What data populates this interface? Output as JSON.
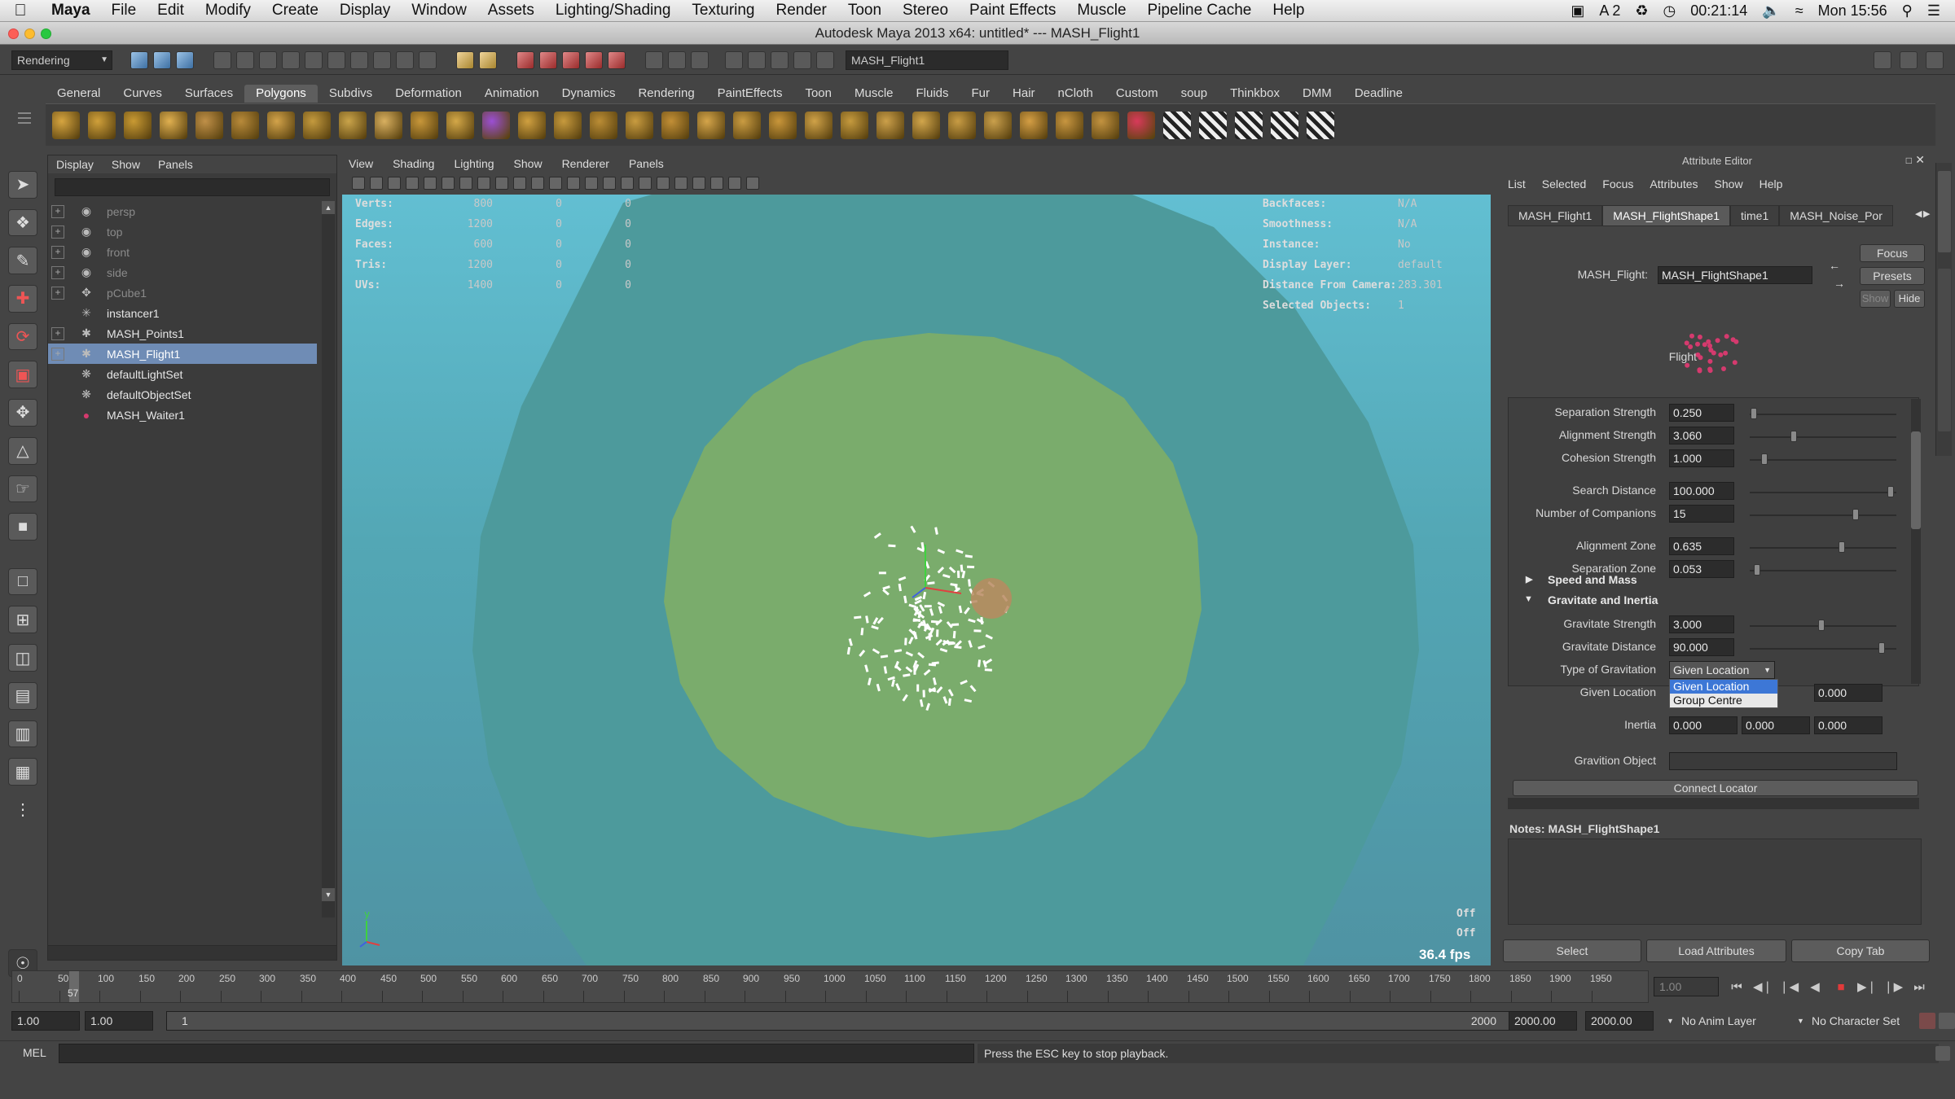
{
  "menubar": {
    "app": "Maya",
    "items": [
      "File",
      "Edit",
      "Modify",
      "Create",
      "Display",
      "Window",
      "Assets",
      "Lighting/Shading",
      "Texturing",
      "Render",
      "Toon",
      "Stereo",
      "Paint Effects",
      "Muscle",
      "Pipeline Cache",
      "Help"
    ],
    "status_a2": "A 2",
    "battery_time": "00:21:14",
    "clock": "Mon 15:56"
  },
  "window": {
    "title": "Autodesk Maya 2013 x64: untitled*   ---   MASH_Flight1"
  },
  "statusline": {
    "menuset": "Rendering",
    "selection_field": "MASH_Flight1"
  },
  "shelf": {
    "tabs": [
      "General",
      "Curves",
      "Surfaces",
      "Polygons",
      "Subdivs",
      "Deformation",
      "Animation",
      "Dynamics",
      "Rendering",
      "PaintEffects",
      "Toon",
      "Muscle",
      "Fluids",
      "Fur",
      "Hair",
      "nCloth",
      "Custom",
      "soup",
      "Thinkbox",
      "DMM",
      "Deadline"
    ],
    "active": "Polygons"
  },
  "outliner": {
    "menu": [
      "Display",
      "Show",
      "Panels"
    ],
    "items": [
      {
        "label": "persp",
        "dim": true,
        "expand": true,
        "icon": "camera-icon"
      },
      {
        "label": "top",
        "dim": true,
        "expand": true,
        "icon": "camera-icon"
      },
      {
        "label": "front",
        "dim": true,
        "expand": true,
        "icon": "camera-icon"
      },
      {
        "label": "side",
        "dim": true,
        "expand": true,
        "icon": "camera-icon"
      },
      {
        "label": "pCube1",
        "dim": true,
        "expand": true,
        "icon": "transform-icon"
      },
      {
        "label": "instancer1",
        "dim": false,
        "expand": false,
        "icon": "instancer-icon"
      },
      {
        "label": "MASH_Points1",
        "dim": false,
        "expand": true,
        "icon": "mash-icon"
      },
      {
        "label": "MASH_Flight1",
        "dim": false,
        "expand": true,
        "icon": "mash-icon",
        "selected": true
      },
      {
        "label": "defaultLightSet",
        "dim": false,
        "expand": false,
        "icon": "set-icon"
      },
      {
        "label": "defaultObjectSet",
        "dim": false,
        "expand": false,
        "icon": "set-icon"
      },
      {
        "label": "MASH_Waiter1",
        "dim": false,
        "expand": false,
        "icon": "mash-waiter-icon"
      }
    ]
  },
  "viewport": {
    "menu": [
      "View",
      "Shading",
      "Lighting",
      "Show",
      "Renderer",
      "Panels"
    ],
    "hud_left": [
      {
        "label": "Verts:",
        "v1": "800",
        "v2": "0",
        "v3": "0"
      },
      {
        "label": "Edges:",
        "v1": "1200",
        "v2": "0",
        "v3": "0"
      },
      {
        "label": "Faces:",
        "v1": "600",
        "v2": "0",
        "v3": "0"
      },
      {
        "label": "Tris:",
        "v1": "1200",
        "v2": "0",
        "v3": "0"
      },
      {
        "label": "UVs:",
        "v1": "1400",
        "v2": "0",
        "v3": "0"
      }
    ],
    "hud_right": [
      {
        "label": "Backfaces:",
        "value": "N/A"
      },
      {
        "label": "Smoothness:",
        "value": "N/A"
      },
      {
        "label": "Instance:",
        "value": "No"
      },
      {
        "label": "Display Layer:",
        "value": "default"
      },
      {
        "label": "Distance From Camera:",
        "value": "283.301"
      },
      {
        "label": "Selected Objects:",
        "value": "1"
      }
    ],
    "off1": "Off",
    "off2": "Off",
    "fps": "36.4 fps",
    "colors": {
      "outer_disc": "#4d9a9c",
      "inner_disc": "#7aac6c",
      "background": "#5cb7c9"
    }
  },
  "attribute_editor": {
    "title": "Attribute Editor",
    "menu": [
      "List",
      "Selected",
      "Focus",
      "Attributes",
      "Show",
      "Help"
    ],
    "tabs": [
      "MASH_Flight1",
      "MASH_FlightShape1",
      "time1",
      "MASH_Noise_Por"
    ],
    "active_tab": "MASH_FlightShape1",
    "node_label": "MASH_Flight:",
    "node_value": "MASH_FlightShape1",
    "focus": "Focus",
    "presets": "Presets",
    "show": "Show",
    "hide": "Hide",
    "flight_label": "Flight",
    "attrs": [
      {
        "label": "Separation Strength",
        "value": "0.250",
        "slider": 0.03
      },
      {
        "label": "Alignment Strength",
        "value": "3.060",
        "slider": 0.3
      },
      {
        "label": "Cohesion Strength",
        "value": "1.000",
        "slider": 0.1
      },
      {
        "label": "Search Distance",
        "value": "100.000",
        "slider": 0.96
      },
      {
        "label": "Number of Companions",
        "value": "15",
        "slider": 0.72
      },
      {
        "label": "Alignment Zone",
        "value": "0.635",
        "slider": 0.63
      },
      {
        "label": "Separation Zone",
        "value": "0.053",
        "slider": 0.05
      }
    ],
    "section_speed": "Speed and Mass",
    "section_gravitate": "Gravitate and Inertia",
    "gravitate_strength_label": "Gravitate Strength",
    "gravitate_strength": "3.000",
    "gravitate_strength_slider": 0.49,
    "gravitate_distance_label": "Gravitate Distance",
    "gravitate_distance": "90.000",
    "gravitate_distance_slider": 0.9,
    "type_label": "Type of Gravitation",
    "type_value": "Given Location",
    "type_options": [
      "Given Location",
      "Group Centre"
    ],
    "given_location_label": "Given Location",
    "given_location": [
      "0.000"
    ],
    "inertia_label": "Inertia",
    "inertia": [
      "0.000",
      "0.000",
      "0.000"
    ],
    "gravition_object_label": "Gravition Object",
    "connect_locator": "Connect Locator",
    "notes": "Notes:  MASH_FlightShape1",
    "buttons": [
      "Select",
      "Load Attributes",
      "Copy Tab"
    ]
  },
  "timeline": {
    "labels": [
      "0",
      "50",
      "100",
      "150",
      "200",
      "250",
      "300",
      "350",
      "400",
      "450",
      "500",
      "550",
      "600",
      "650",
      "700",
      "750",
      "800",
      "850",
      "900",
      "950",
      "1000",
      "1050",
      "1100",
      "1150",
      "1200",
      "1250",
      "1300",
      "1350",
      "1400",
      "1450",
      "1500",
      "1550",
      "1600",
      "1650",
      "1700",
      "1750",
      "1800",
      "1850",
      "1900",
      "1950"
    ],
    "current_frame": "57",
    "current_value": "1.00"
  },
  "range": {
    "start": "1.00",
    "playback_start": "1.00",
    "slider_start": "1",
    "slider_end": "2000",
    "playback_end": "2000.00",
    "end": "2000.00",
    "anim_layer": "No Anim Layer",
    "char_set": "No Character Set"
  },
  "commandline": {
    "label": "MEL",
    "help": "Press the ESC key to stop playback."
  }
}
